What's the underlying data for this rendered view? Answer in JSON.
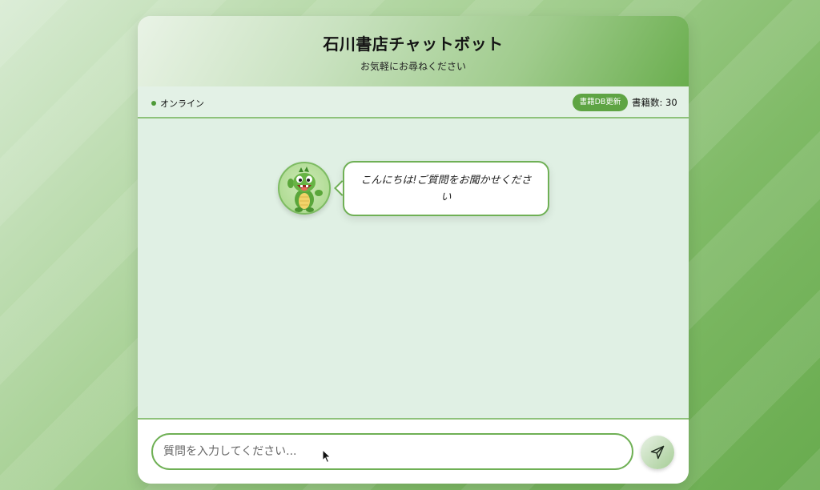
{
  "header": {
    "title": "石川書店チャットボット",
    "subtitle": "お気軽にお尋ねください"
  },
  "status": {
    "online_label": "オンライン",
    "update_button": "書籍DB更新",
    "book_count": "書籍数: 30"
  },
  "chat": {
    "messages": [
      {
        "sender": "bot",
        "text": "こんにちは!ご質問をお聞かせください",
        "avatar": "dragon-mascot"
      }
    ]
  },
  "input": {
    "placeholder": "質問を入力してください...",
    "value": "",
    "send_icon": "send-icon"
  },
  "colors": {
    "accent": "#5ea443",
    "border": "#6fb055",
    "chat_bg": "#e0f0e4"
  }
}
